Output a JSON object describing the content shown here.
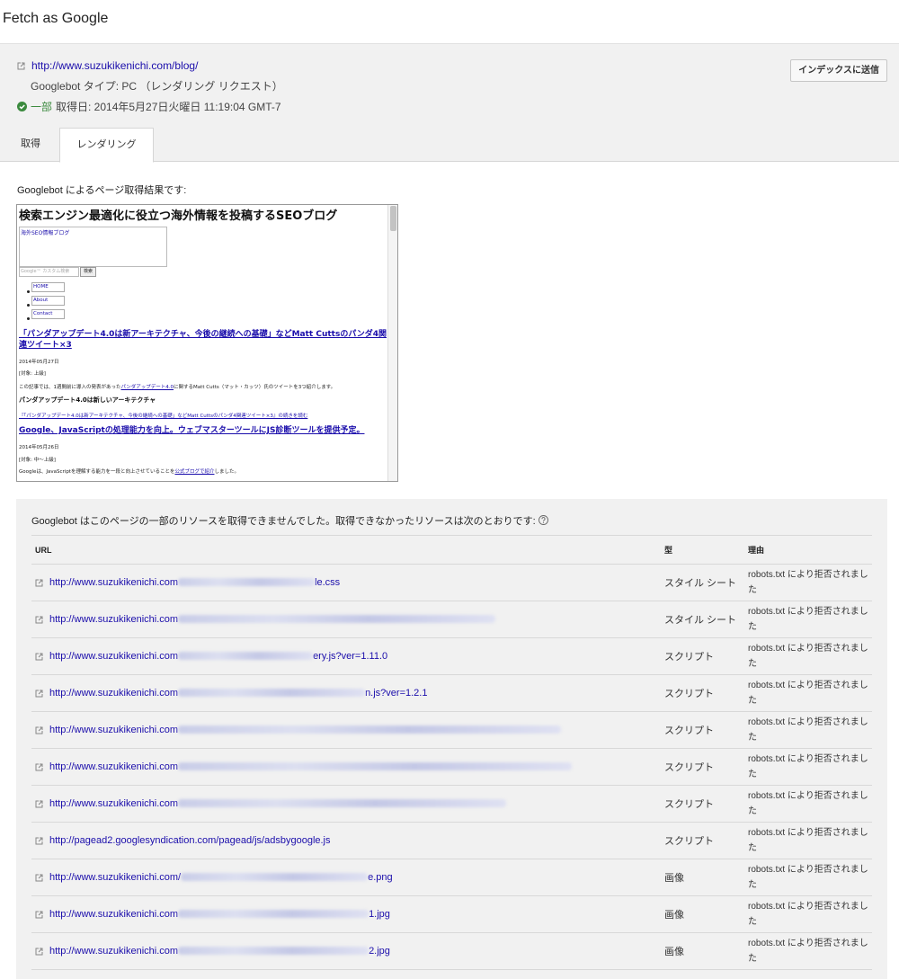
{
  "page": {
    "title": "Fetch as Google"
  },
  "fetch": {
    "url": "http://www.suzukikenichi.com/blog/",
    "agent_line": "Googlebot タイプ: PC （レンダリング リクエスト）",
    "status_word": "一部",
    "status_detail": "取得日: 2014年5月27日火曜日 11:19:04 GMT-7",
    "submit_label": "インデックスに送信",
    "tabs": {
      "fetch": "取得",
      "render": "レンダリング"
    }
  },
  "render": {
    "result_label": "Googlebot によるページ取得結果です:",
    "preview": {
      "heading": "検索エンジン最適化に役立つ海外情報を投稿するSEOブログ",
      "banner_text": "海外SEO情報ブログ",
      "search_placeholder": "Google™ カスタム検索",
      "search_button": "検索",
      "nav": [
        "HOME",
        "About",
        "Contact"
      ],
      "post1_title": "「パンダアップデート4.0は新アーキテクチャ、今後の継続への基礎」などMatt Cuttsのパンダ4関連ツイート×3",
      "post1_date": "2014年05月27日",
      "post1_level": "[対象: 上級]",
      "post1_body_pre": "この記事では、1週間前に導入の発表があった",
      "post1_body_link": "パンダアップデート4.0",
      "post1_body_post": "に関するMatt Cutts（マット・カッツ）氏のツイートを3つ紹介します。",
      "post1_sub": "パンダアップデート4.0は新しいアーキテクチャ",
      "post1_more": "『「パンダアップデート4.0は新アーキテクチャ、今後の継続への基礎」などMatt Cuttsのパンダ4関連ツイート×3』の続きを読む",
      "post2_title": "Google、JavaScriptの処理能力を向上。ウェブマスターツールにJS診断ツールを提供予定。",
      "post2_date": "2014年05月26日",
      "post2_level": "[対象: 中～上級]",
      "post2_body_pre": "Googleは、JavaScriptを理解する能力を一段と向上させていることを",
      "post2_body_link": "公式ブログで紹介",
      "post2_body_post": "しました。"
    }
  },
  "resources": {
    "message": "Googlebot はこのページの一部のリソースを取得できませんでした。取得できなかったリソースは次のとおりです:",
    "headers": {
      "url": "URL",
      "type": "型",
      "reason": "理由"
    },
    "rows": [
      {
        "url_prefix": "http://www.suzukikenichi.com",
        "url_suffix": "le.css",
        "blur_width": 152,
        "type": "スタイル シート",
        "reason": "robots.txt により拒否されました"
      },
      {
        "url_prefix": "http://www.suzukikenichi.com",
        "url_suffix": "",
        "blur_width": 353,
        "type": "スタイル シート",
        "reason": "robots.txt により拒否されました"
      },
      {
        "url_prefix": "http://www.suzukikenichi.com",
        "url_suffix": "ery.js?ver=1.11.0",
        "blur_width": 150,
        "type": "スクリプト",
        "reason": "robots.txt により拒否されました"
      },
      {
        "url_prefix": "http://www.suzukikenichi.com",
        "url_suffix": "n.js?ver=1.2.1",
        "blur_width": 208,
        "type": "スクリプト",
        "reason": "robots.txt により拒否されました"
      },
      {
        "url_prefix": "http://www.suzukikenichi.com",
        "url_suffix": "",
        "blur_width": 426,
        "type": "スクリプト",
        "reason": "robots.txt により拒否されました"
      },
      {
        "url_prefix": "http://www.suzukikenichi.com",
        "url_suffix": "",
        "blur_width": 438,
        "type": "スクリプト",
        "reason": "robots.txt により拒否されました"
      },
      {
        "url_prefix": "http://www.suzukikenichi.com",
        "url_suffix": "",
        "blur_width": 365,
        "type": "スクリプト",
        "reason": "robots.txt により拒否されました"
      },
      {
        "url_prefix": "http://pagead2.googlesyndication.com/pagead/js/adsbygoogle.js",
        "url_suffix": "",
        "blur_width": 0,
        "type": "スクリプト",
        "reason": "robots.txt により拒否されました"
      },
      {
        "url_prefix": "http://www.suzukikenichi.com/",
        "url_suffix": "e.png",
        "blur_width": 208,
        "type": "画像",
        "reason": "robots.txt により拒否されました"
      },
      {
        "url_prefix": "http://www.suzukikenichi.com",
        "url_suffix": "1.jpg",
        "blur_width": 212,
        "type": "画像",
        "reason": "robots.txt により拒否されました"
      },
      {
        "url_prefix": "http://www.suzukikenichi.com",
        "url_suffix": "2.jpg",
        "blur_width": 212,
        "type": "画像",
        "reason": "robots.txt により拒否されました"
      }
    ]
  },
  "colors": {
    "link": "#1a0dab",
    "panel": "#f1f1f1",
    "ok": "#3b8a3e"
  },
  "icons": {
    "external": "external-link-icon",
    "status": "check-circle-icon",
    "help": "help-circle-icon"
  }
}
